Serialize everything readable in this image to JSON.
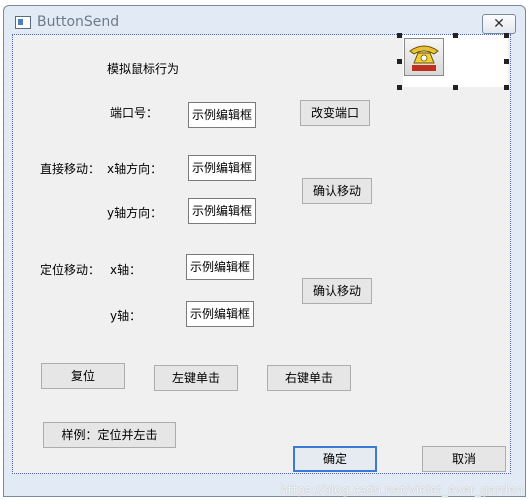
{
  "window": {
    "title": "ButtonSend",
    "close_glyph": "✕"
  },
  "labels": {
    "heading": "模拟鼠标行为",
    "port": "端口号：",
    "direct_move": "直接移动：",
    "x_direction": "x轴方向：",
    "y_direction": "y轴方向：",
    "position_move": "定位移动：",
    "x_axis": "x轴：",
    "y_axis": "y轴："
  },
  "edits": {
    "port": "示例编辑框",
    "direct_x": "示例编辑框",
    "direct_y": "示例编辑框",
    "pos_x": "示例编辑框",
    "pos_y": "示例编辑框"
  },
  "buttons": {
    "change_port": "改变端口",
    "confirm_move_1": "确认移动",
    "confirm_move_2": "确认移动",
    "reset": "复位",
    "left_click": "左键单击",
    "right_click": "右键单击",
    "sample": "样例：定位并左击",
    "ok": "确定",
    "cancel": "取消"
  },
  "icons": {
    "picture": "telephone-icon",
    "app": "dialog-icon"
  },
  "watermark": "https://blog.csdn.net/violet_ever_garden"
}
